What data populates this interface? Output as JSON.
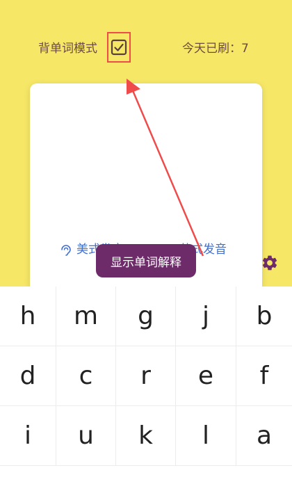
{
  "header": {
    "mode_label": "背单词模式",
    "mode_checked": true,
    "count_label": "今天已刷：7"
  },
  "card": {
    "pronunciations": [
      {
        "label": "美式发音",
        "icon": "speaker-icon"
      },
      {
        "label": "英式发音"
      }
    ]
  },
  "tooltip": {
    "text": "显示单词解释"
  },
  "settings_icon": "gear-icon",
  "keyboard": {
    "keys": [
      "h",
      "m",
      "g",
      "j",
      "b",
      "d",
      "c",
      "r",
      "e",
      "f",
      "i",
      "u",
      "k",
      "l",
      "a"
    ]
  },
  "colors": {
    "background": "#f6e767",
    "tooltip": "#6e2b6a",
    "highlight": "#f04b4b",
    "link": "#3f6fd0",
    "accent": "#6e2b6a"
  }
}
